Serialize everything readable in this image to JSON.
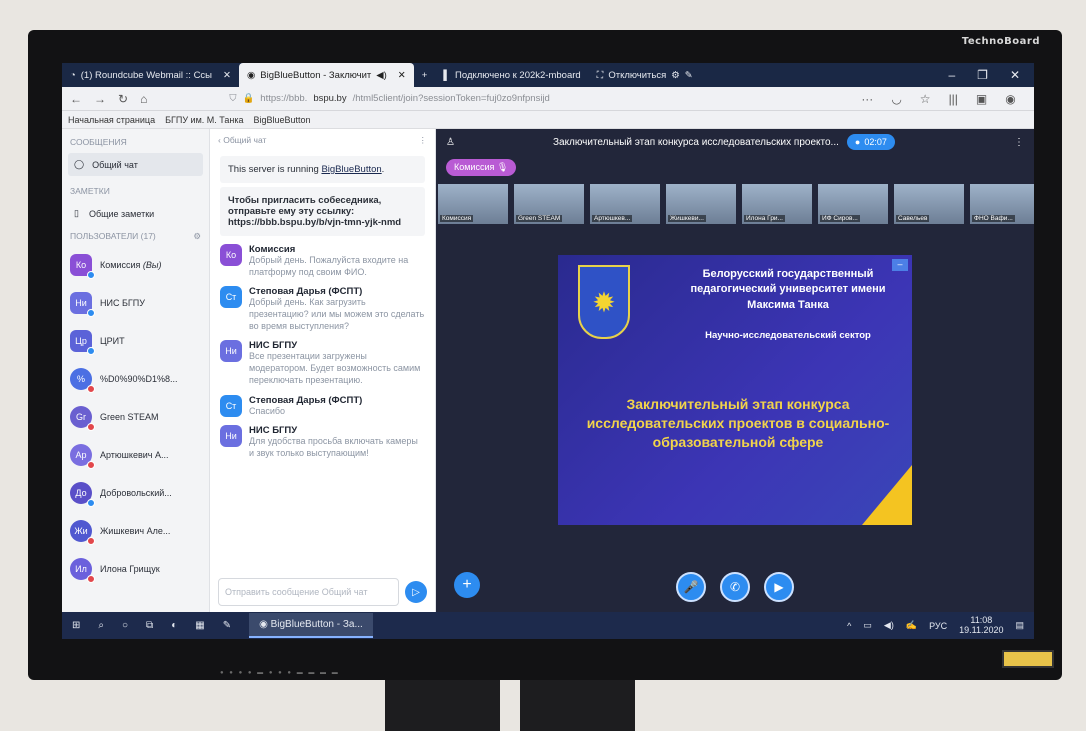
{
  "monitor": {
    "brand": "TechnoBoard"
  },
  "browser": {
    "tabs": [
      {
        "label": "(1) Roundcube Webmail :: Ссы",
        "active": false
      },
      {
        "label": "BigBlueButton - Заключит",
        "active": true
      },
      {
        "label": "Подключено к 202k2-mboard",
        "active": false
      },
      {
        "label": "Отключиться",
        "active": false
      }
    ],
    "url_prefix": "https://bbb.",
    "url_host": "bspu.by",
    "url_path": "/html5client/join?sessionToken=fuj0zo9nfpnsijd",
    "bookmarks": [
      "Начальная страница",
      "БГПУ им. М. Танка",
      "BigBlueButton"
    ]
  },
  "sidebar": {
    "messages_header": "СООБЩЕНИЯ",
    "public_chat": "Общий чат",
    "notes_header": "ЗАМЕТКИ",
    "shared_notes": "Общие заметки",
    "users_header": "ПОЛЬЗОВАТЕЛИ (17)",
    "users": [
      {
        "initials": "Ко",
        "name": "Комиссия",
        "suffix": "(Вы)",
        "color": "#8a4fd6",
        "dot": "#2d8cf0",
        "round": false
      },
      {
        "initials": "Ни",
        "name": "НИС БГПУ",
        "suffix": "",
        "color": "#6b6fe0",
        "dot": "#2d8cf0",
        "round": false
      },
      {
        "initials": "Цр",
        "name": "ЦРИТ",
        "suffix": "",
        "color": "#5b62d8",
        "dot": "#2d8cf0",
        "round": false
      },
      {
        "initials": "%",
        "name": "%D0%90%D1%8...",
        "suffix": "",
        "color": "#4b6fe3",
        "dot": "#e2474b",
        "round": true
      },
      {
        "initials": "Gr",
        "name": "Green STEAM",
        "suffix": "",
        "color": "#6a5fd0",
        "dot": "#e2474b",
        "round": true
      },
      {
        "initials": "Ар",
        "name": "Артюшкевич А...",
        "suffix": "",
        "color": "#7a6ee0",
        "dot": "#e2474b",
        "round": true
      },
      {
        "initials": "До",
        "name": "Добровольский...",
        "suffix": "",
        "color": "#5a4fc8",
        "dot": "#2d8cf0",
        "round": true
      },
      {
        "initials": "Жи",
        "name": "Жишкевич Але...",
        "suffix": "",
        "color": "#5058d0",
        "dot": "#e2474b",
        "round": true
      },
      {
        "initials": "Ил",
        "name": "Илона Грищук",
        "suffix": "",
        "color": "#6b60dc",
        "dot": "#e2474b",
        "round": true
      }
    ]
  },
  "chat": {
    "title": "Общий чат",
    "system_text": "This server is running ",
    "system_link": "BigBlueButton",
    "invite_text": "Чтобы пригласить собеседника, отправьте ему эту ссылку:",
    "invite_link": "https://bbb.bspu.by/b/vjn-tmn-yjk-nmd",
    "messages": [
      {
        "initials": "Ко",
        "color": "#8a4fd6",
        "name": "Комиссия",
        "text": "Добрый день. Пожалуйста входите на платформу под своим ФИО."
      },
      {
        "initials": "Ст",
        "color": "#2d8cf0",
        "name": "Степовая Дарья (ФСПТ)",
        "text": "Добрый день. Как загрузить презентацию? или мы можем это сделать во время выступления?"
      },
      {
        "initials": "Ни",
        "color": "#6b6fe0",
        "name": "НИС БГПУ",
        "text": "Все презентации загружены модератором. Будет возможность самим переключать презентацию."
      },
      {
        "initials": "Ст",
        "color": "#2d8cf0",
        "name": "Степовая Дарья (ФСПТ)",
        "text": "Спасибо"
      },
      {
        "initials": "Ни",
        "color": "#6b6fe0",
        "name": "НИС БГПУ",
        "text": "Для удобства просьба включать камеры и звук только выступающим!"
      }
    ],
    "input_placeholder": "Отправить сообщение Общий чат"
  },
  "stage": {
    "title": "Заключительный этап конкурса исследовательских проекто...",
    "recording_time": "02:07",
    "talking_badge": "Комиссия",
    "thumbnails": [
      "Комиссия",
      "Green STEAM",
      "Артюшкев...",
      "Жишкеви...",
      "Илона Гри...",
      "ИФ Сиров...",
      "Савельев",
      "ФНО Вафи..."
    ],
    "slide": {
      "university": "Белорусский государственный педагогический университет имени Максима Танка",
      "sector": "Научно-исследовательский сектор",
      "headline": "Заключительный этап конкурса исследовательских проектов в социально-образовательной сфере",
      "collapse": "–"
    }
  },
  "taskbar": {
    "app_label": "BigBlueButton - За...",
    "language": "РУС",
    "time": "11:08",
    "date": "19.11.2020"
  }
}
